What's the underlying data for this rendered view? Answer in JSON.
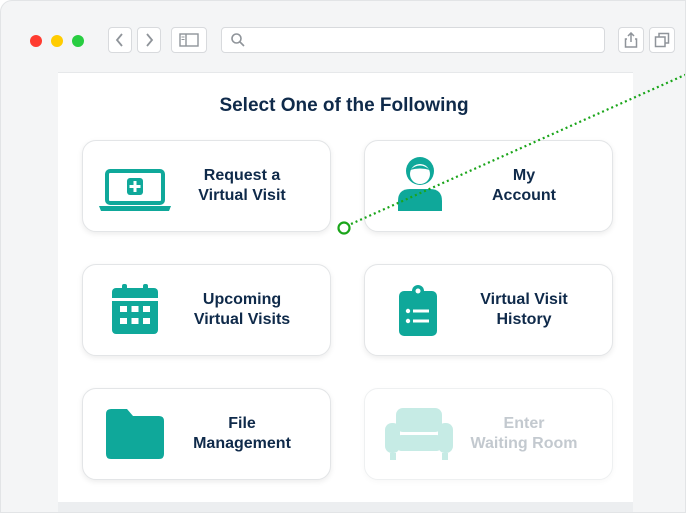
{
  "browser": {
    "controls": [
      "close-dot",
      "minimize-dot",
      "maximize-dot"
    ],
    "icons": [
      "chevron-left-icon",
      "chevron-right-icon",
      "sidebar-icon",
      "search-icon",
      "share-icon",
      "tabs-icon"
    ],
    "address_value": ""
  },
  "main": {
    "heading": "Select One of the Following",
    "cards": [
      {
        "line1": "Request a",
        "line2": "Virtual Visit",
        "icon": "laptop-medical-icon"
      },
      {
        "line1": "My",
        "line2": "Account",
        "icon": "user-icon"
      },
      {
        "line1": "Upcoming",
        "line2": "Virtual Visits",
        "icon": "calendar-icon"
      },
      {
        "line1": "Virtual Visit",
        "line2": "History",
        "icon": "clipboard-list-icon"
      },
      {
        "line1": "File",
        "line2": "Management",
        "icon": "folder-icon"
      },
      {
        "line1": "Enter",
        "line2": "Waiting Room",
        "icon": "couch-icon",
        "disabled": true
      }
    ]
  },
  "colors": {
    "accent": "#0fa89a",
    "text": "#0f2a4a",
    "disabled": "#c3c9cf",
    "pointer_line": "#1aa51a"
  }
}
